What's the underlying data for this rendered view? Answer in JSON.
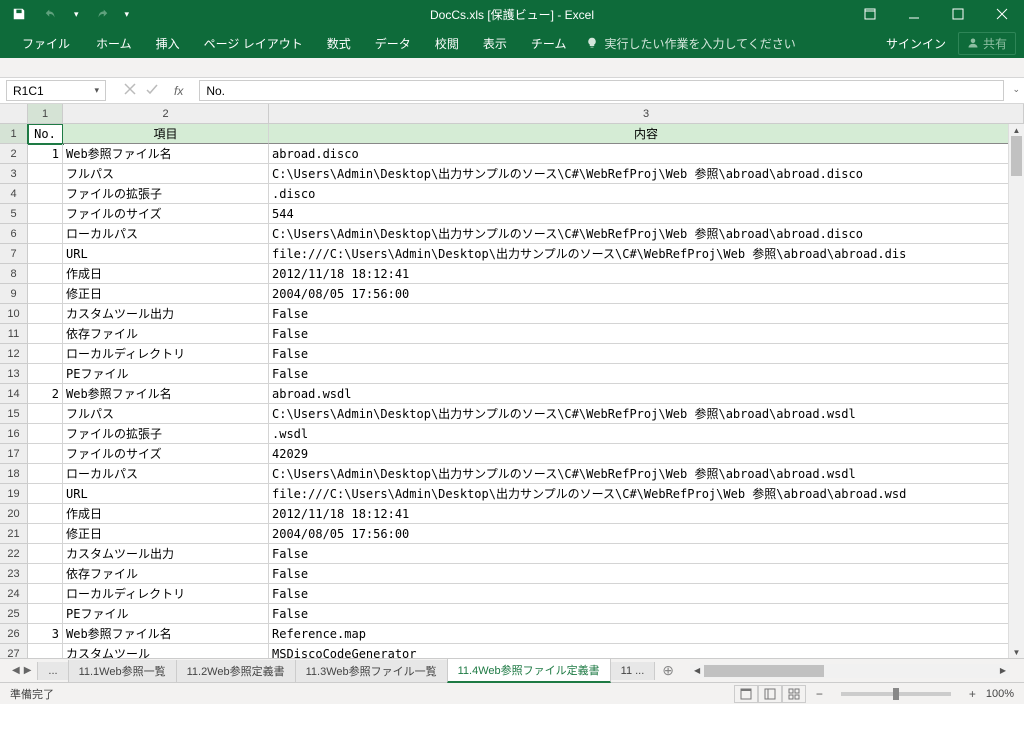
{
  "title": "DocCs.xls [保護ビュー] - Excel",
  "qat": {
    "save": "save",
    "undo": "undo",
    "redo": "redo"
  },
  "tabs": [
    "ファイル",
    "ホーム",
    "挿入",
    "ページ レイアウト",
    "数式",
    "データ",
    "校閲",
    "表示",
    "チーム"
  ],
  "tellme": "実行したい作業を入力してください",
  "signin": "サインイン",
  "share": "共有",
  "namebox": "R1C1",
  "formula": "No.",
  "columns": {
    "c1": "1",
    "c2": "2",
    "c3": "3"
  },
  "headers": {
    "c1": "No.",
    "c2": "項目",
    "c3": "内容"
  },
  "rows": [
    {
      "n": "1",
      "no": "",
      "k": "",
      "v": "",
      "hdr": true
    },
    {
      "n": "2",
      "no": "1",
      "k": "Web参照ファイル名",
      "v": "abroad.disco"
    },
    {
      "n": "3",
      "no": "",
      "k": "フルパス",
      "v": "C:\\Users\\Admin\\Desktop\\出力サンプルのソース\\C#\\WebRefProj\\Web 参照\\abroad\\abroad.disco"
    },
    {
      "n": "4",
      "no": "",
      "k": "ファイルの拡張子",
      "v": ".disco"
    },
    {
      "n": "5",
      "no": "",
      "k": "ファイルのサイズ",
      "v": "544"
    },
    {
      "n": "6",
      "no": "",
      "k": "ローカルパス",
      "v": "C:\\Users\\Admin\\Desktop\\出力サンプルのソース\\C#\\WebRefProj\\Web 参照\\abroad\\abroad.disco"
    },
    {
      "n": "7",
      "no": "",
      "k": "URL",
      "v": "file:///C:\\Users\\Admin\\Desktop\\出力サンプルのソース\\C#\\WebRefProj\\Web 参照\\abroad\\abroad.dis"
    },
    {
      "n": "8",
      "no": "",
      "k": "作成日",
      "v": "2012/11/18 18:12:41"
    },
    {
      "n": "9",
      "no": "",
      "k": "修正日",
      "v": "2004/08/05 17:56:00"
    },
    {
      "n": "10",
      "no": "",
      "k": "カスタムツール出力",
      "v": "False"
    },
    {
      "n": "11",
      "no": "",
      "k": "依存ファイル",
      "v": "False"
    },
    {
      "n": "12",
      "no": "",
      "k": "ローカルディレクトリ",
      "v": "False"
    },
    {
      "n": "13",
      "no": "",
      "k": "PEファイル",
      "v": "False"
    },
    {
      "n": "14",
      "no": "2",
      "k": "Web参照ファイル名",
      "v": "abroad.wsdl"
    },
    {
      "n": "15",
      "no": "",
      "k": "フルパス",
      "v": "C:\\Users\\Admin\\Desktop\\出力サンプルのソース\\C#\\WebRefProj\\Web 参照\\abroad\\abroad.wsdl"
    },
    {
      "n": "16",
      "no": "",
      "k": "ファイルの拡張子",
      "v": ".wsdl"
    },
    {
      "n": "17",
      "no": "",
      "k": "ファイルのサイズ",
      "v": "42029"
    },
    {
      "n": "18",
      "no": "",
      "k": "ローカルパス",
      "v": "C:\\Users\\Admin\\Desktop\\出力サンプルのソース\\C#\\WebRefProj\\Web 参照\\abroad\\abroad.wsdl"
    },
    {
      "n": "19",
      "no": "",
      "k": "URL",
      "v": "file:///C:\\Users\\Admin\\Desktop\\出力サンプルのソース\\C#\\WebRefProj\\Web 参照\\abroad\\abroad.wsd"
    },
    {
      "n": "20",
      "no": "",
      "k": "作成日",
      "v": "2012/11/18 18:12:41"
    },
    {
      "n": "21",
      "no": "",
      "k": "修正日",
      "v": "2004/08/05 17:56:00"
    },
    {
      "n": "22",
      "no": "",
      "k": "カスタムツール出力",
      "v": "False"
    },
    {
      "n": "23",
      "no": "",
      "k": "依存ファイル",
      "v": "False"
    },
    {
      "n": "24",
      "no": "",
      "k": "ローカルディレクトリ",
      "v": "False"
    },
    {
      "n": "25",
      "no": "",
      "k": "PEファイル",
      "v": "False"
    },
    {
      "n": "26",
      "no": "3",
      "k": "Web参照ファイル名",
      "v": "Reference.map"
    },
    {
      "n": "27",
      "no": "",
      "k": "カスタムツール",
      "v": "MSDiscoCodeGenerator"
    }
  ],
  "sheetTabs": {
    "ellipsis": "...",
    "t1": "11.1Web参照一覧",
    "t2": "11.2Web参照定義書",
    "t3": "11.3Web参照ファイル一覧",
    "t4": "11.4Web参照ファイル定義書",
    "t5": "11 ..."
  },
  "status": "準備完了",
  "zoom": "100%"
}
